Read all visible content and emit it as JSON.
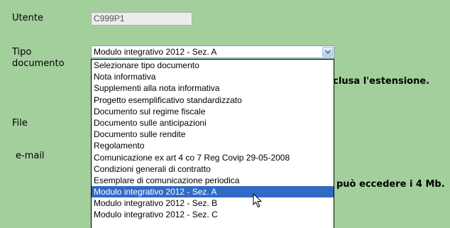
{
  "form": {
    "user_label": "Utente",
    "user_value": "C999P1",
    "doc_type_label_line1": "Tipo",
    "doc_type_label_line2": "documento",
    "file_label": "File",
    "email_label": "e-mail",
    "note_extension_fragment": "nclusa l'estensione.",
    "note_size_fragment": "può eccedere i 4 Mb."
  },
  "select": {
    "selected_value": "Modulo integrativo 2012 - Sez. A",
    "arrow_icon": "chevron-down-icon",
    "options": [
      "Selezionare tipo documento",
      "Nota informativa",
      "Supplementi alla nota informativa",
      "Progetto esemplificativo standardizzato",
      "Documento sul regime fiscale",
      "Documento sulle anticipazioni",
      "Documento sulle rendite",
      "Regolamento",
      "Comunicazione ex art 4 co 7 Reg Covip 29-05-2008",
      "Condizioni generali di contratto",
      "Esemplare di comunicazione periodica",
      "Modulo integrativo 2012 - Sez. A",
      "Modulo integrativo 2012 - Sez. B",
      "Modulo integrativo 2012 - Sez. C"
    ],
    "highlighted_index": 11
  },
  "colors": {
    "page_background": "#a3cf9c",
    "highlight": "#316ac5"
  },
  "cursor_icon": "mouse-pointer-icon"
}
